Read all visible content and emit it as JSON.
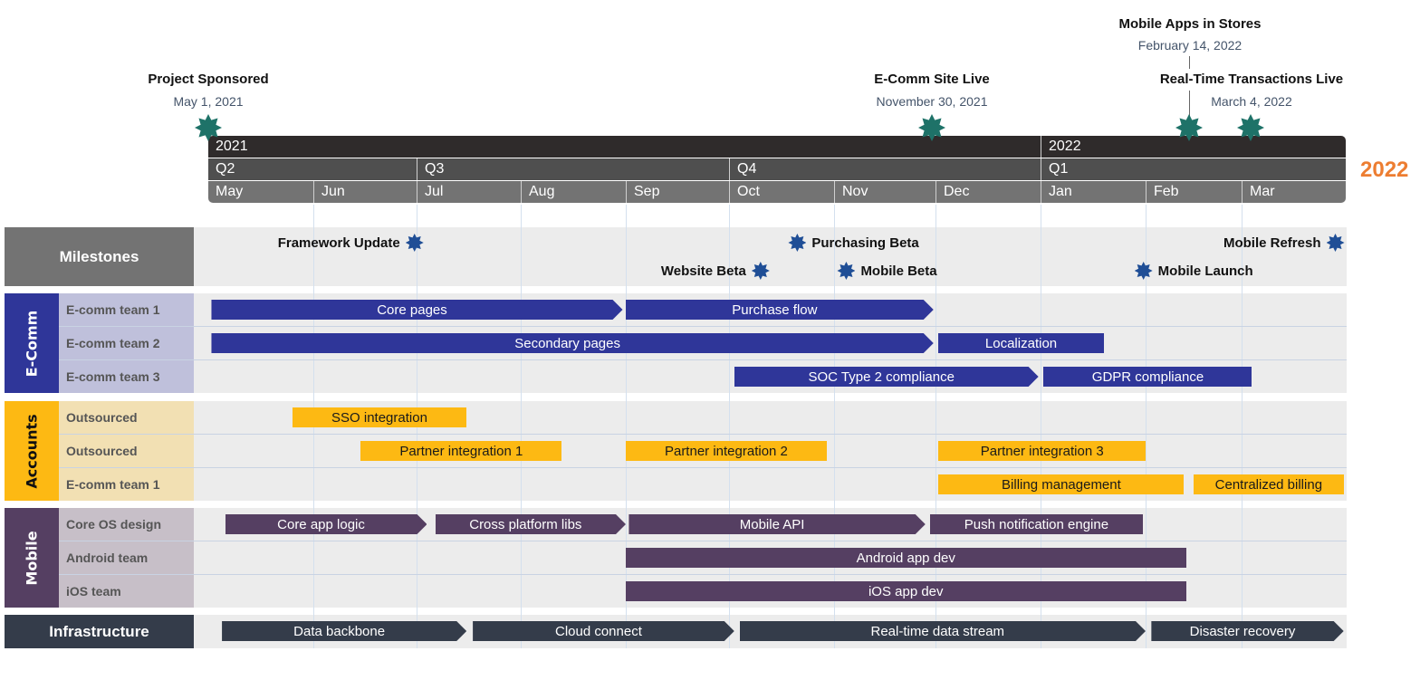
{
  "chart_data": {
    "type": "gantt",
    "title": "",
    "year_badge": "2022",
    "colors": {
      "accent_orange": "#ed7d31",
      "key_milestone": "#1e7268",
      "milestone": "#1f4e96",
      "ecomm": "#2f3699",
      "ecomm_light": "#bfc0db",
      "accounts": "#fdb913",
      "accounts_light": "#f2e0b3",
      "mobile": "#553f62",
      "mobile_light": "#c7bfc8",
      "infra": "#343c4a",
      "milestones_header": "#737373",
      "year_row": "#2f2b2b",
      "quarter_row": "#4f4f4f",
      "month_row": "#737373"
    },
    "timescale": {
      "years": [
        {
          "label": "2021",
          "start": "2021-05",
          "months": 8
        },
        {
          "label": "2022",
          "start": "2022-01",
          "months": 3
        }
      ],
      "quarters": [
        {
          "label": "Q2",
          "months": 2
        },
        {
          "label": "Q3",
          "months": 3
        },
        {
          "label": "Q4",
          "months": 3
        },
        {
          "label": "Q1",
          "months": 3
        }
      ],
      "months": [
        "May",
        "Jun",
        "Jul",
        "Aug",
        "Sep",
        "Oct",
        "Nov",
        "Dec",
        "Jan",
        "Feb",
        "Mar"
      ],
      "range_months": [
        0,
        11
      ]
    },
    "key_milestones": [
      {
        "title": "Project Sponsored",
        "date": "May 1, 2021",
        "pos": 0.0
      },
      {
        "title": "E-Comm Site Live",
        "date": "November 30, 2021",
        "pos": 6.97
      },
      {
        "title": "Mobile Apps in Stores",
        "date": "February 14, 2022",
        "pos": 9.45
      },
      {
        "title": "Real-Time Transactions Live",
        "date": "March 4, 2022",
        "pos": 10.13
      }
    ],
    "milestones_label": "Milestones",
    "milestones": [
      {
        "label": "Framework Update",
        "pos": 1.98,
        "row": 0,
        "side": "left"
      },
      {
        "label": "Purchasing Beta",
        "pos": 5.65,
        "row": 0,
        "side": "right"
      },
      {
        "label": "Mobile Refresh",
        "pos": 10.9,
        "row": 0,
        "side": "left"
      },
      {
        "label": "Website Beta",
        "pos": 5.3,
        "row": 1,
        "side": "left"
      },
      {
        "label": "Mobile Beta",
        "pos": 6.12,
        "row": 1,
        "side": "right"
      },
      {
        "label": "Mobile Launch",
        "pos": 8.98,
        "row": 1,
        "side": "right"
      }
    ],
    "groups": [
      {
        "name": "E-Comm",
        "color_key": "ecomm",
        "light_key": "ecomm_light",
        "bar_style": "blue",
        "rows": [
          {
            "team": "E-comm team 1",
            "tasks": [
              {
                "label": "Core pages",
                "start": 0.03,
                "end": 3.97,
                "arrow": true
              },
              {
                "label": "Purchase flow",
                "start": 4.0,
                "end": 6.98,
                "arrow": true
              }
            ]
          },
          {
            "team": "E-comm team 2",
            "tasks": [
              {
                "label": "Secondary pages",
                "start": 0.03,
                "end": 6.98,
                "arrow": true
              },
              {
                "label": "Localization",
                "start": 7.03,
                "end": 8.6,
                "arrow": false
              }
            ]
          },
          {
            "team": "E-comm team 3",
            "tasks": [
              {
                "label": "SOC Type 2 compliance",
                "start": 5.05,
                "end": 7.98,
                "arrow": true
              },
              {
                "label": "GDPR compliance",
                "start": 8.03,
                "end": 10.1,
                "arrow": false
              }
            ]
          }
        ]
      },
      {
        "name": "Accounts",
        "color_key": "accounts",
        "light_key": "accounts_light",
        "bar_style": "yellow",
        "rows": [
          {
            "team": "Outsourced",
            "tasks": [
              {
                "label": "SSO integration",
                "start": 0.8,
                "end": 2.48,
                "arrow": false
              }
            ]
          },
          {
            "team": "Outsourced",
            "tasks": [
              {
                "label": "Partner integration 1",
                "start": 1.46,
                "end": 3.39,
                "arrow": false
              },
              {
                "label": "Partner integration 2",
                "start": 4.0,
                "end": 5.93,
                "arrow": false
              }
            ]
          },
          {
            "team": "E-comm team 1",
            "tasks": [
              {
                "label": "Partner integration 3",
                "start": 7.03,
                "end": 9.0,
                "arrow": false,
                "row_override": 1
              },
              {
                "label": "Billing management",
                "start": 7.03,
                "end": 9.4,
                "arrow": false
              },
              {
                "label": "Centralized billing",
                "start": 9.5,
                "end": 10.98,
                "arrow": false
              }
            ]
          }
        ]
      },
      {
        "name": "Mobile",
        "color_key": "mobile",
        "light_key": "mobile_light",
        "bar_style": "purple",
        "rows": [
          {
            "team": "Core OS design",
            "tasks": [
              {
                "label": "Core app logic",
                "start": 0.16,
                "end": 2.1,
                "arrow": true
              },
              {
                "label": "Cross platform libs",
                "start": 2.18,
                "end": 4.0,
                "arrow": true
              },
              {
                "label": "Mobile API",
                "start": 4.03,
                "end": 6.9,
                "arrow": true
              },
              {
                "label": "Push notification engine",
                "start": 6.95,
                "end": 8.97,
                "arrow": false
              }
            ]
          },
          {
            "team": "Android team",
            "tasks": [
              {
                "label": "Android app dev",
                "start": 4.0,
                "end": 9.42,
                "arrow": false
              }
            ]
          },
          {
            "team": "iOS team",
            "tasks": [
              {
                "label": "iOS app dev",
                "start": 4.0,
                "end": 9.42,
                "arrow": false
              }
            ]
          }
        ]
      },
      {
        "name": "Infrastructure",
        "color_key": "infra",
        "light_key": "infra",
        "bar_style": "dark",
        "rows": [
          {
            "team": "",
            "tasks": [
              {
                "label": "Data backbone",
                "start": 0.13,
                "end": 2.48,
                "arrow": true
              },
              {
                "label": "Cloud connect",
                "start": 2.54,
                "end": 5.05,
                "arrow": true
              },
              {
                "label": "Real-time data stream",
                "start": 5.1,
                "end": 9.0,
                "arrow": true
              },
              {
                "label": "Disaster recovery",
                "start": 9.06,
                "end": 10.98,
                "arrow": true
              }
            ]
          }
        ]
      }
    ]
  }
}
